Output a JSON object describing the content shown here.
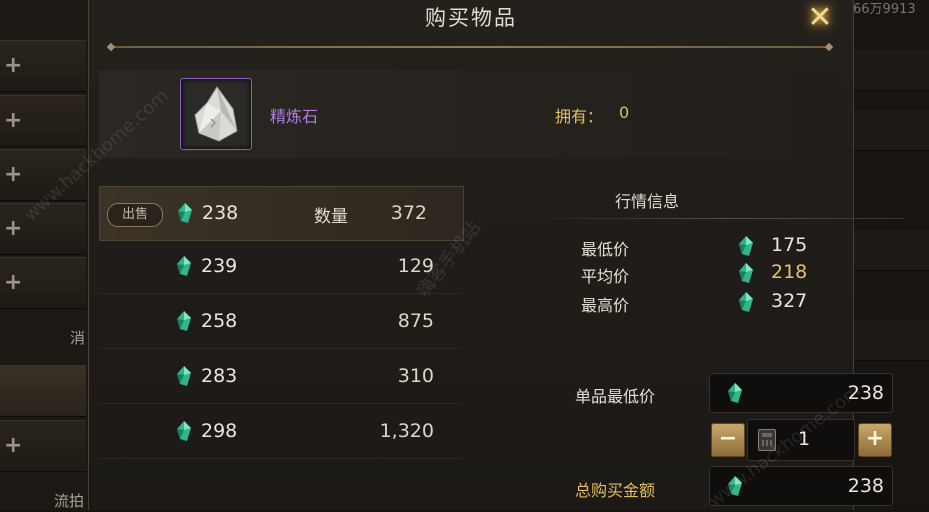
{
  "dialog": {
    "title": "购买物品",
    "close_icon": "close-sparkle-icon"
  },
  "item": {
    "name": "精炼石",
    "icon": "refining-stone-crystal-icon",
    "owned_label": "拥有：",
    "owned_value": "0"
  },
  "listings": {
    "sell_badge": "出售",
    "qty_label": "数量",
    "currency_icon": "green-gem-icon",
    "rows": [
      {
        "price": "238",
        "qty": "372"
      },
      {
        "price": "239",
        "qty": "129"
      },
      {
        "price": "258",
        "qty": "875"
      },
      {
        "price": "283",
        "qty": "310"
      },
      {
        "price": "298",
        "qty": "1,320"
      }
    ]
  },
  "market": {
    "title": "行情信息",
    "stats": [
      {
        "label": "最低价",
        "value": "175",
        "color": "#ece6dc"
      },
      {
        "label": "平均价",
        "value": "218",
        "color": "#e2c36e"
      },
      {
        "label": "最高价",
        "value": "327",
        "color": "#ece6dc"
      }
    ]
  },
  "purchase": {
    "unit_price_label": "单品最低价",
    "unit_price_value": "238",
    "quantity_value": "1",
    "total_label": "总购买金额",
    "total_value": "238",
    "decrement_icon": "minus-icon",
    "increment_icon": "plus-icon",
    "calculator_icon": "calculator-icon"
  },
  "background": {
    "side_labels": [
      "消",
      "流拍"
    ],
    "corner_text": "66万9913"
  },
  "watermark": {
    "site": "www.hackhome.com",
    "name": "嗨客手机站"
  },
  "colors": {
    "accent_gold": "#e0bf62",
    "item_purple": "#b27be6",
    "gem_green": "#2fb58a"
  }
}
